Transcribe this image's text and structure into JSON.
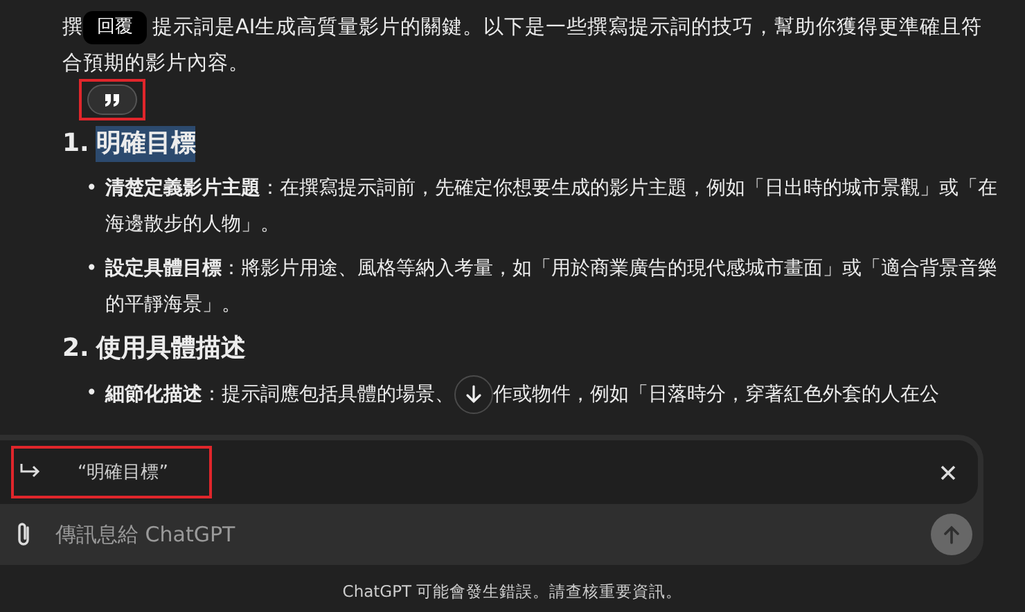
{
  "paragraph": {
    "start": "撰",
    "rest": "提示詞是AI生成高質量影片的關鍵。以下是一些撰寫提示詞的技巧，幫助你獲得更準確且符",
    "line_2": "合預期的影片內容。"
  },
  "quote_popup": {
    "tooltip": "回覆"
  },
  "sections": [
    {
      "number": "1.",
      "title": "明確目標",
      "selected": true,
      "bullets": [
        {
          "marker": "•",
          "text": "**清楚定義影片主題**：在撰寫提示詞前，先確定你想要生成的影片主題，例如「日出時的城市景觀」或「在海邊散步的人物」。"
        },
        {
          "marker": "•",
          "text": "**設定具體目標**：將影片用途、風格等納入考量，如「用於商業廣告的現代感城市畫面」或「適合背景音樂的平靜海景」。"
        }
      ]
    },
    {
      "number": "2.",
      "title": "使用具體描述",
      "selected": false,
      "bullets": [
        {
          "marker": "•",
          "text": "**細節化描述**：提示詞應包括具體的場景、",
          "text_after_button": "作或物件，例如「日落時分，穿著紅色外套的人在公"
        }
      ]
    }
  ],
  "reply": {
    "quote": "“明確目標”"
  },
  "composer": {
    "placeholder": "傳訊息給 ChatGPT",
    "send_disabled": true
  },
  "footer": "ChatGPT 可能會發生錯誤。請查核重要資訊。"
}
